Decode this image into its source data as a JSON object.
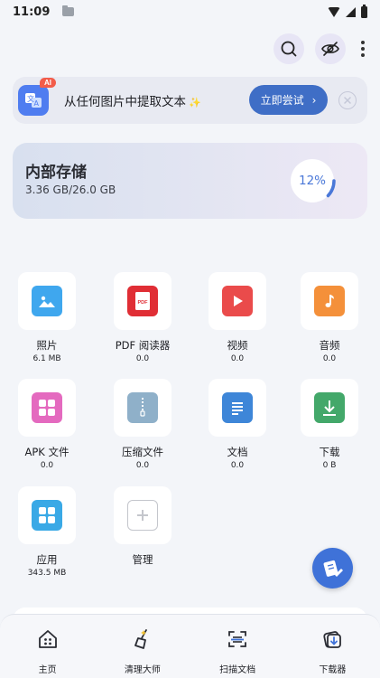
{
  "status_bar": {
    "time": "11:09"
  },
  "ai_banner": {
    "badge": "AI",
    "text": "从任何图片中提取文本",
    "sparkle": "✨",
    "button_label": "立即尝试",
    "button_arrow": "›"
  },
  "storage": {
    "title": "内部存储",
    "size": "3.36 GB/26.0 GB",
    "percent_label": "12%",
    "used_fraction": 0.12,
    "ring_color": "#4a78d8"
  },
  "categories": [
    {
      "label": "照片",
      "sub": "6.1 MB",
      "icon": "photo-icon",
      "color": "#3fa7ee"
    },
    {
      "label": "PDF 阅读器",
      "sub": "0.0",
      "icon": "pdf-icon",
      "color": "#e02e35"
    },
    {
      "label": "视频",
      "sub": "0.0",
      "icon": "video-icon",
      "color": "#ea4b4b"
    },
    {
      "label": "音频",
      "sub": "0.0",
      "icon": "music-icon",
      "color": "#f4903a"
    },
    {
      "label": "APK 文件",
      "sub": "0.0",
      "icon": "apk-icon",
      "color": "#e46abf"
    },
    {
      "label": "压缩文件",
      "sub": "0.0",
      "icon": "zip-icon",
      "color": "#8fb0c9"
    },
    {
      "label": "文档",
      "sub": "0.0",
      "icon": "document-icon",
      "color": "#3e86d8"
    },
    {
      "label": "下载",
      "sub": "0 B",
      "icon": "download-icon",
      "color": "#43a86a"
    },
    {
      "label": "应用",
      "sub": "343.5 MB",
      "icon": "apps-icon",
      "color": "#3aa9e6"
    },
    {
      "label": "管理",
      "sub": "",
      "icon": "add-icon",
      "color": "#c4c6cc"
    }
  ],
  "bottom_nav": [
    {
      "label": "主页",
      "icon": "home-icon"
    },
    {
      "label": "清理大师",
      "icon": "broom-icon"
    },
    {
      "label": "扫描文档",
      "icon": "scan-icon"
    },
    {
      "label": "下载器",
      "icon": "downloader-icon"
    }
  ]
}
